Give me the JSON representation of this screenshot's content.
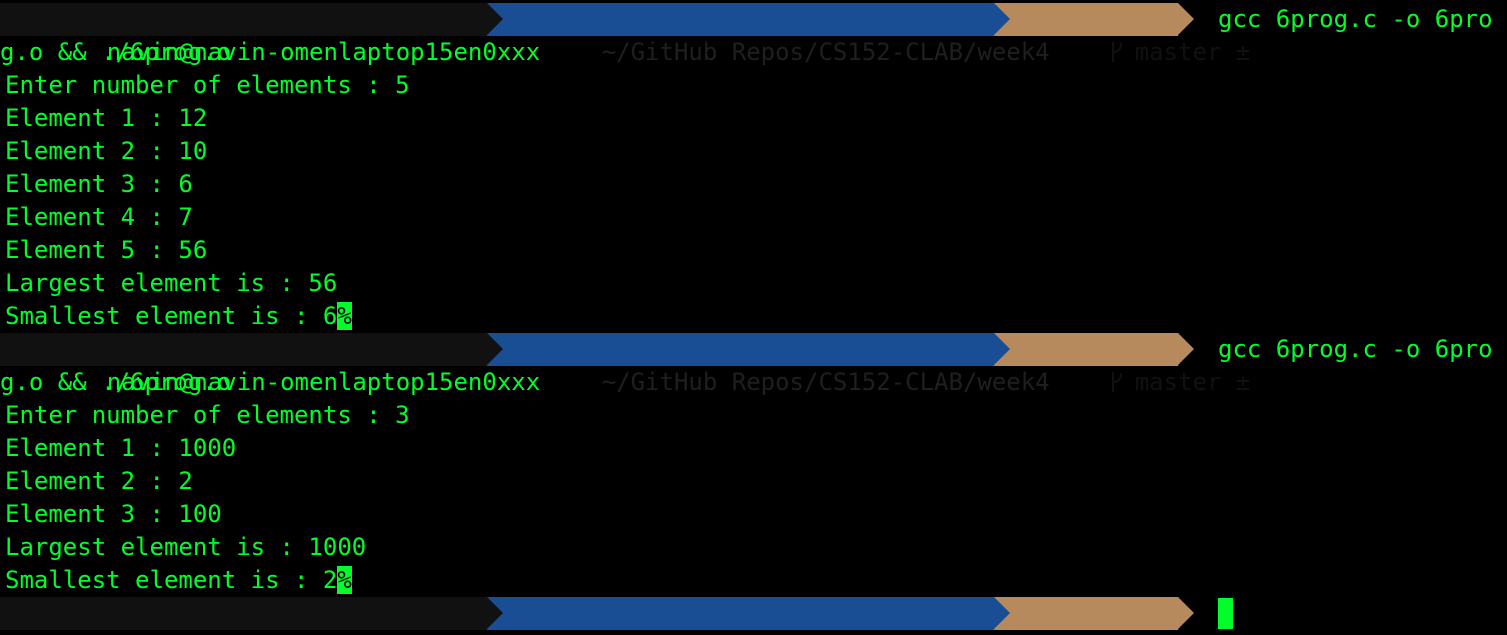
{
  "prompt": {
    "user_host": "navin@navin-omenlaptop15en0xxx",
    "path": "~/GitHub Repos/CS152-CLAB/week4",
    "branch": "master ±",
    "branch_icon": "git-branch-icon"
  },
  "run1": {
    "command": "gcc 6prog.c -o 6pro",
    "command_wrap": "g.o && ./6prog.o",
    "output": [
      "Enter number of elements : 5",
      "Element 1 : 12",
      "Element 2 : 10",
      "Element 3 : 6",
      "Element 4 : 7",
      "Element 5 : 56",
      "Largest element is : 56"
    ],
    "last_line": "Smallest element is : 6",
    "eol_marker": "%"
  },
  "run2": {
    "command": "gcc 6prog.c -o 6pro",
    "command_wrap": "g.o && ./6prog.o",
    "output": [
      "Enter number of elements : 3",
      "Element 1 : 1000",
      "Element 2 : 2",
      "Element 3 : 100",
      "Largest element is : 1000"
    ],
    "last_line": "Smallest element is : 2",
    "eol_marker": "%"
  },
  "colors": {
    "background": "#000000",
    "text": "#00ff2a",
    "user_segment": "#111111",
    "path_segment": "#1a4e94",
    "git_segment": "#b78a5e"
  }
}
